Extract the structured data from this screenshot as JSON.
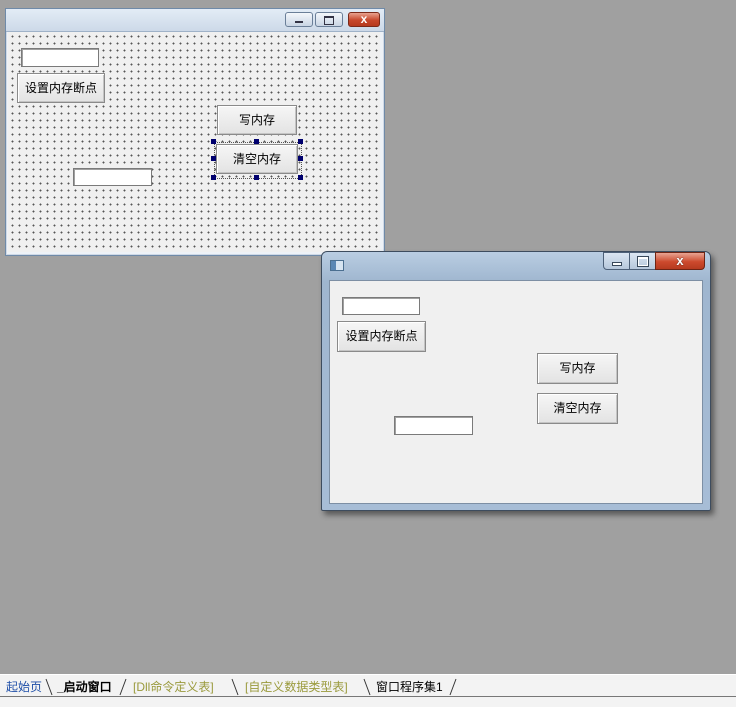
{
  "design_form": {
    "set_breakpoint_label": "设置内存断点",
    "write_memory_label": "写内存",
    "clear_memory_label": "清空内存",
    "input_top_value": "",
    "input_bottom_value": ""
  },
  "runtime_window": {
    "set_breakpoint_label": "设置内存断点",
    "write_memory_label": "写内存",
    "clear_memory_label": "清空内存",
    "input_top_value": "",
    "input_bottom_value": "",
    "close_glyph": "x"
  },
  "tabs": [
    {
      "label": "起始页",
      "color": "#1f4fa8",
      "active": false
    },
    {
      "label": "_启动窗口",
      "color": "#000000",
      "active": true
    },
    {
      "label": "[Dll命令定义表]",
      "color": "#9a9a3c",
      "active": false
    },
    {
      "label": "[自定义数据类型表]",
      "color": "#9a9a3c",
      "active": false
    },
    {
      "label": "窗口程序集1",
      "color": "#000000",
      "active": false
    }
  ],
  "colors": {
    "workspace_bg": "#a0a0a0",
    "selection_handle": "#00006e"
  }
}
